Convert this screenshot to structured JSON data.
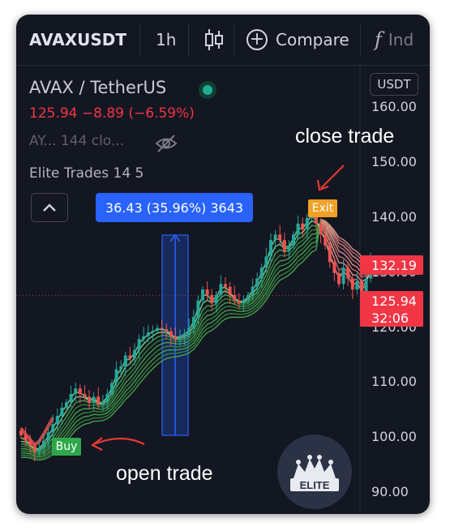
{
  "toolbar": {
    "symbol": "AVAXUSDT",
    "interval": "1h",
    "chart_type_icon": "candlestick-icon",
    "compare_label": "Compare",
    "indicators_label": "Ind"
  },
  "legend": {
    "title": "AVAX / TetherUS",
    "price_change": "125.94  −8.89 (−6.59%)",
    "volume_text": "AY...  144 clo...",
    "indicator": "Elite Trades 14 5"
  },
  "currency_button": "USDT",
  "price_axis": [
    "160.00",
    "150.00",
    "140.00",
    "130.00",
    "120.00",
    "110.00",
    "100.00",
    "90.00"
  ],
  "measure_label": "36.43 (35.96%) 3643",
  "signals": {
    "buy": "Buy",
    "exit": "Exit"
  },
  "price_boxes": {
    "ema": "132.19",
    "last": "125.94",
    "countdown": "32:06"
  },
  "annotations": {
    "close": "close trade",
    "open": "open trade"
  },
  "colors": {
    "up": "#26a69a",
    "down": "#ef5350",
    "ribbon": "#4caf50",
    "accent": "#2962ff",
    "exit": "#f0a126"
  },
  "chart_data": {
    "type": "candlestick",
    "ylim": [
      90,
      165
    ],
    "y_ticks": [
      160,
      150,
      140,
      130,
      120,
      110,
      100,
      90
    ],
    "last_price": 125.94,
    "buy_price": 100.5,
    "exit_price": 141,
    "close_path": [
      100.5,
      99.5,
      98.5,
      97.5,
      98.2,
      99.5,
      101,
      102.5,
      104,
      105.5,
      106.5,
      108,
      109,
      108,
      107.5,
      106.5,
      107.5,
      106,
      106.5,
      108,
      110,
      112.5,
      113,
      115,
      114.5,
      116,
      118,
      118.5,
      119.2,
      119.5,
      120,
      119.8,
      119.4,
      118.5,
      118,
      118.5,
      119,
      120,
      122,
      125,
      127,
      126,
      124.5,
      126,
      128,
      127.5,
      126,
      125,
      124.5,
      125,
      126,
      127.5,
      129,
      131,
      133,
      136,
      137,
      136,
      134,
      135,
      137,
      139,
      138,
      140,
      141,
      139,
      137,
      135,
      132,
      130,
      128,
      131,
      129,
      127,
      128.5,
      126,
      129,
      132
    ]
  }
}
